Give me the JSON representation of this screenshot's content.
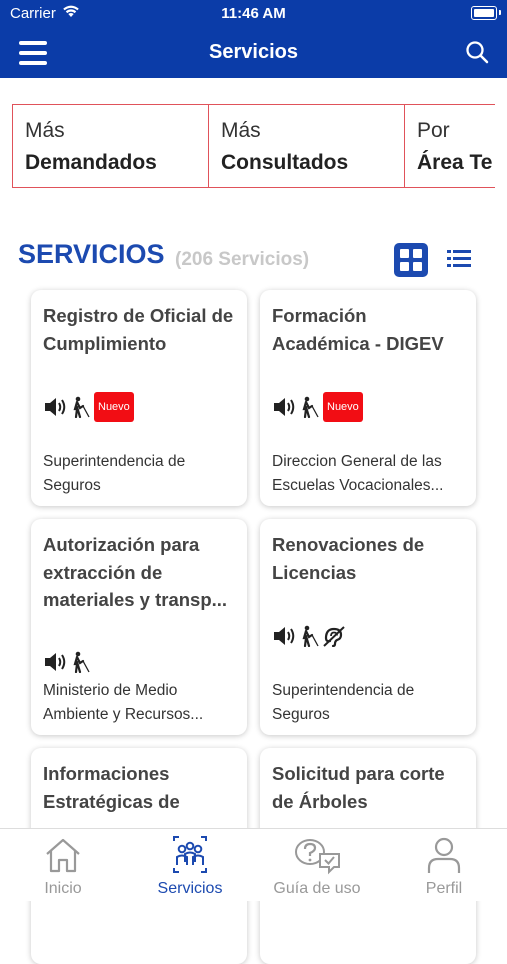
{
  "status": {
    "carrier": "Carrier",
    "time": "11:46 AM"
  },
  "header": {
    "title": "Servicios"
  },
  "categories": [
    {
      "l1": "Más",
      "l2": "Demandados"
    },
    {
      "l1": "Más",
      "l2": "Consultados"
    },
    {
      "l1": "Por",
      "l2": "Área Te"
    }
  ],
  "section": {
    "title": "SERVICIOS",
    "count": "(206 Servicios)"
  },
  "cards": [
    {
      "title": "Registro de Oficial de Cumplimiento",
      "org": "Superintendencia de Seguros",
      "badge": "Nuevo"
    },
    {
      "title": "Formación Académica - DIGEV",
      "org": "Direccion General de las Escuelas Vocacionales...",
      "badge": "Nuevo"
    },
    {
      "title": "Autorización para extracción de materiales y transp...",
      "org": "Ministerio de Medio Ambiente y Recursos..."
    },
    {
      "title": "Renovaciones de Licencias",
      "org": "Superintendencia de Seguros"
    },
    {
      "title": "Informaciones Estratégicas de",
      "org": ""
    },
    {
      "title": "Solicitud para corte de Árboles",
      "org": ""
    }
  ],
  "tabs": [
    {
      "label": "Inicio",
      "icon": "home-icon"
    },
    {
      "label": "Servicios",
      "icon": "people-group-icon"
    },
    {
      "label": "Guía de uso",
      "icon": "help-chat-icon"
    },
    {
      "label": "Perfil",
      "icon": "user-icon"
    }
  ],
  "colors": {
    "primary": "#0b3ca8",
    "accent": "#1c4ab0",
    "badge": "#f20d14",
    "cat_border": "#e0525a"
  }
}
